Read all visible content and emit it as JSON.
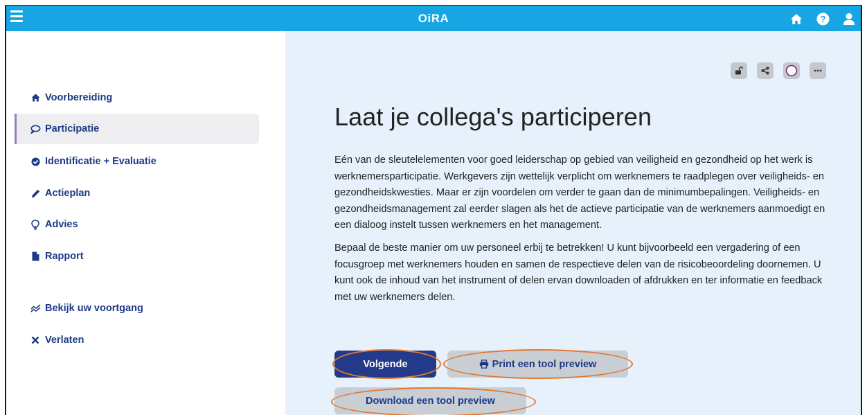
{
  "app": {
    "logo_text": "OiRA"
  },
  "topbar": {
    "icons": [
      "menu-icon",
      "home-icon",
      "help-icon",
      "user-icon"
    ]
  },
  "sidebar": {
    "items": [
      {
        "label": "Voorbereiding",
        "icon": "home-icon",
        "active": false
      },
      {
        "label": "Participatie",
        "icon": "chat-icon",
        "active": true
      },
      {
        "label": "Identificatie + Evaluatie",
        "icon": "check-circle-icon",
        "active": false
      },
      {
        "label": "Actieplan",
        "icon": "pencil-icon",
        "active": false
      },
      {
        "label": "Advies",
        "icon": "lightbulb-icon",
        "active": false
      },
      {
        "label": "Rapport",
        "icon": "document-icon",
        "active": false
      },
      {
        "label": "Bekijk uw voortgang",
        "icon": "trend-icon",
        "active": false
      },
      {
        "label": "Verlaten",
        "icon": "close-icon",
        "active": false
      }
    ]
  },
  "toolbar": {
    "icons": [
      "unlock-icon",
      "share-icon",
      "status-circle-icon",
      "more-icon"
    ]
  },
  "main": {
    "title": "Laat je collega's participeren",
    "paragraph1": "Eén van de sleutelelementen voor goed leiderschap op gebied van veiligheid en gezondheid op het werk is werknemersparticipatie. Werkgevers zijn wettelijk verplicht om werknemers te raadplegen over veiligheids- en gezondheidskwesties. Maar er zijn voordelen om verder te gaan dan de minimumbepalingen. Veiligheids- en gezondheidsmanagement zal eerder slagen als het de actieve participatie van de werknemers aanmoedigt en een dialoog instelt tussen werknemers en het management.",
    "paragraph2": "Bepaal de beste manier om uw personeel erbij te betrekken! U kunt bijvoorbeeld een vergadering of een focusgroep met werknemers houden en samen de respectieve delen van de risicobeoordeling doornemen. U kunt ook de inhoud van het instrument of delen ervan downloaden of afdrukken en ter informatie en feedback met uw werknemers delen."
  },
  "buttons": {
    "next_label": "Volgende",
    "print_label": "Print een tool preview",
    "download_label": "Download een tool preview"
  },
  "colors": {
    "topbar": "#17a6e3",
    "nav_text": "#1d3a86",
    "primary_button": "#233a8a",
    "content_bg": "#e6f1fb",
    "highlight_ring": "#e3782f"
  }
}
